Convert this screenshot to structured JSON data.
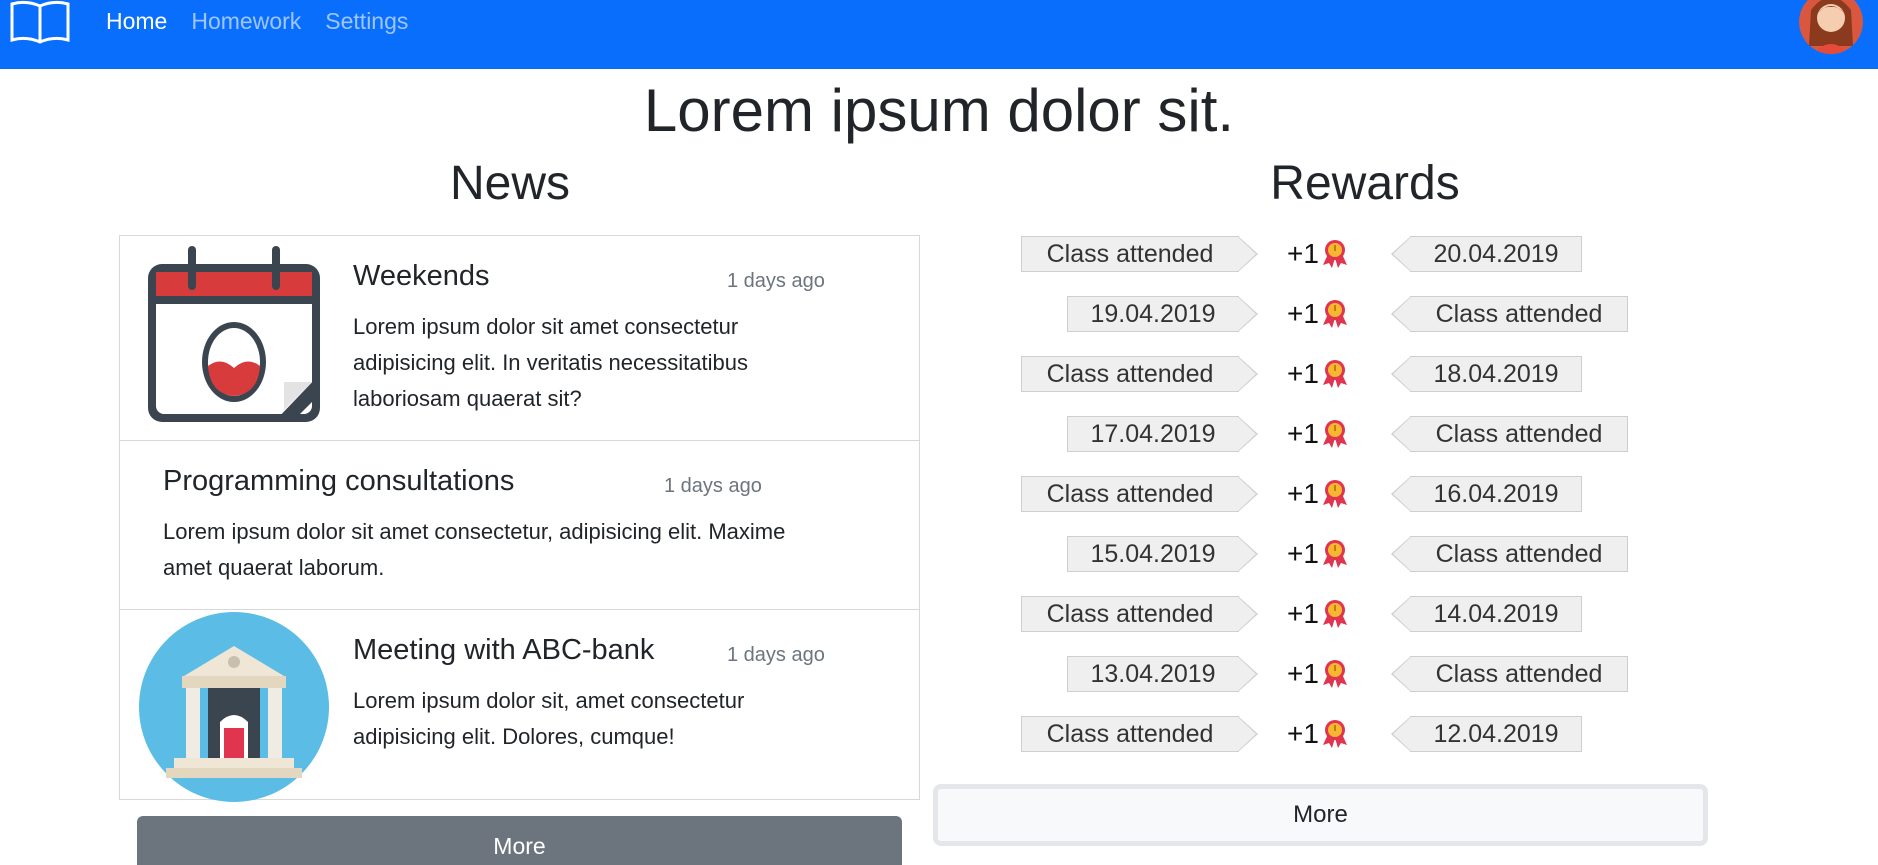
{
  "navbar": {
    "brand_icon": "book-icon",
    "links": [
      {
        "label": "Home",
        "active": true
      },
      {
        "label": "Homework",
        "active": false
      },
      {
        "label": "Settings",
        "active": false
      }
    ],
    "avatar_icon": "user-avatar-icon"
  },
  "page": {
    "title": "Lorem ipsum dolor sit."
  },
  "news": {
    "title": "News",
    "items": [
      {
        "title": "Weekends",
        "time": "1 days ago",
        "text": "Lorem ipsum dolor sit amet consectetur adipisicing elit. In veritatis necessitatibus laboriosam quaerat sit?",
        "icon": "calendar-egg-icon"
      },
      {
        "title": "Programming consultations",
        "time": "1 days ago",
        "text": "Lorem ipsum dolor sit amet consectetur, adipisicing elit. Maxime amet quaerat laborum."
      },
      {
        "title": "Meeting with ABC-bank",
        "time": "1 days ago",
        "text": "Lorem ipsum dolor sit, amet consectetur adipisicing elit. Dolores, cumque!",
        "icon": "bank-icon"
      }
    ],
    "more_label": "More"
  },
  "rewards": {
    "title": "Rewards",
    "points_label": "+1",
    "medal_icon": "medal-icon",
    "rows": [
      {
        "left": "Class attended",
        "right": "20.04.2019"
      },
      {
        "left": "19.04.2019",
        "right": "Class attended"
      },
      {
        "left": "Class attended",
        "right": "18.04.2019"
      },
      {
        "left": "17.04.2019",
        "right": "Class attended"
      },
      {
        "left": "Class attended",
        "right": "16.04.2019"
      },
      {
        "left": "15.04.2019",
        "right": "Class attended"
      },
      {
        "left": "Class attended",
        "right": "14.04.2019"
      },
      {
        "left": "13.04.2019",
        "right": "Class attended"
      },
      {
        "left": "Class attended",
        "right": "12.04.2019"
      }
    ],
    "more_label": "More"
  },
  "colors": {
    "navbar": "#0a6efd",
    "news_more": "#6c757d",
    "medal": "#e0344f"
  }
}
